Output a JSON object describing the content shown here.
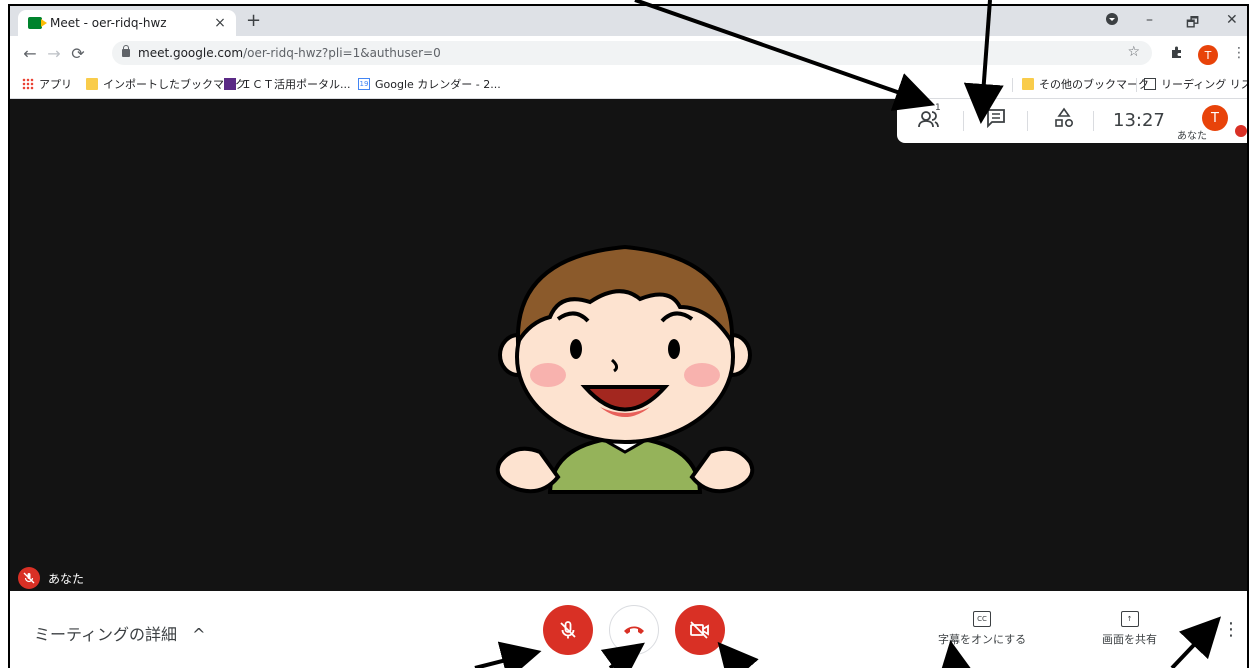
{
  "browser": {
    "tab_title": "Meet - oer-ridq-hwz",
    "tab_close": "×",
    "new_tab": "+",
    "url_host": "meet.google.com",
    "url_path": "/oer-ridq-hwz?pli=1&authuser=0",
    "profile_initial": "T",
    "window_controls": [
      "–",
      "🗗",
      "✕"
    ]
  },
  "bookmarks": {
    "apps": "アプリ",
    "items": [
      "インポートしたブックマーク",
      "ＩＣＴ活用ポータル...",
      "Google カレンダー - 2..."
    ],
    "other": "その他のブックマーク",
    "reading_list": "リーディング リスト"
  },
  "meet": {
    "participants_count": "1",
    "clock": "13:27",
    "self_initial": "T",
    "self_label": "あなた",
    "tile_name": "あなた",
    "meeting_details": "ミーティングの詳細",
    "captions_label": "字幕をオンにする",
    "present_label": "画面を共有"
  },
  "colors": {
    "meet_background": "#131313",
    "control_red": "#d93025",
    "avatar_orange": "#e8430a"
  }
}
